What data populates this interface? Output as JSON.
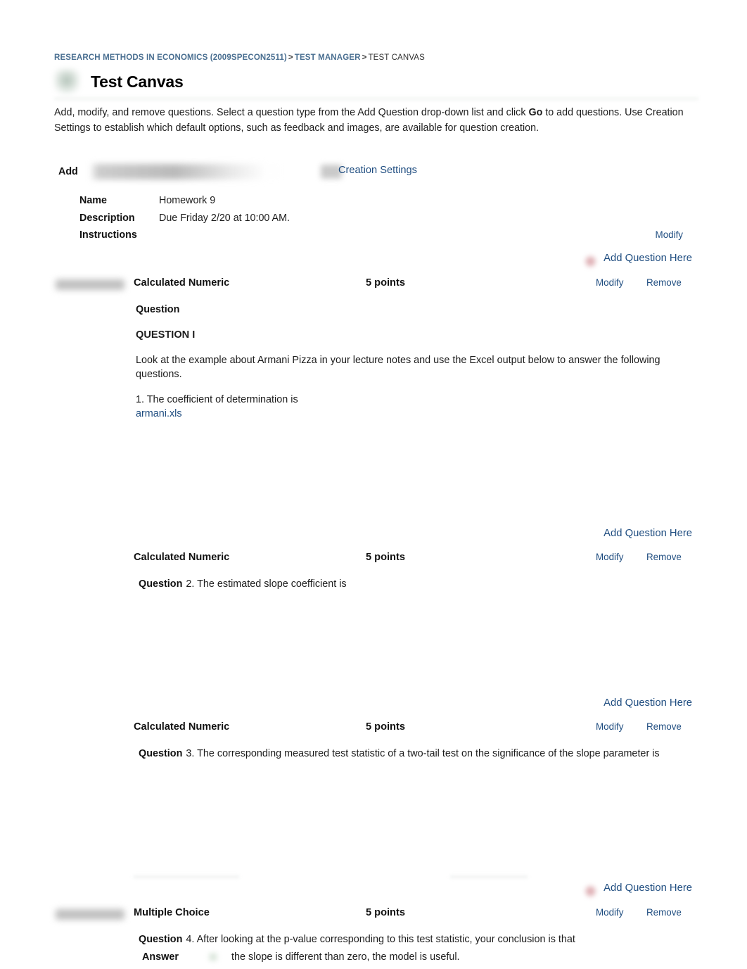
{
  "breadcrumb": {
    "course": "RESEARCH METHODS IN ECONOMICS (2009SPECON2511)",
    "sep1": ">",
    "section": "TEST MANAGER",
    "sep2": ">",
    "current": "TEST CANVAS"
  },
  "header": {
    "title": "Test Canvas",
    "icon": "test-canvas-icon"
  },
  "intro": {
    "part1": "Add, modify, and remove questions. Select a question type from the Add Question drop-down list and click ",
    "bold": "Go",
    "part2": " to add questions. Use Creation Settings to establish which default options, such as feedback and images, are available for question creation."
  },
  "toolbar": {
    "add_label": "Add",
    "question_type_value": "",
    "go_label": "",
    "creation_settings_label": "Creation Settings"
  },
  "meta": {
    "name_key": "Name",
    "name_value": "Homework 9",
    "description_key": "Description",
    "description_value": "Due Friday 2/20 at 10:00 AM.",
    "instructions_key": "Instructions",
    "instructions_value": "",
    "modify_label": "Modify"
  },
  "labels": {
    "add_question_here": "Add Question Here",
    "modify": "Modify",
    "remove": "Remove",
    "question": "Question",
    "answer": "Answer"
  },
  "questions": [
    {
      "type": "Calculated Numeric",
      "points": "5 points",
      "question_label": "Question",
      "heading": "QUESTION I",
      "body": "Look at the example about Armani Pizza in your lecture notes and use the Excel output below to answer the following questions.",
      "prompt": "1. The coefficient of determination is",
      "attachment": "armani.xls",
      "has_marker": true,
      "has_thumb": true
    },
    {
      "type": "Calculated Numeric",
      "points": "5 points",
      "question_label": "Question",
      "prompt": "2. The estimated slope coefficient is",
      "has_marker": false,
      "has_thumb": false
    },
    {
      "type": "Calculated Numeric",
      "points": "5 points",
      "question_label": "Question",
      "prompt": "3. The corresponding measured test statistic of a two-tail test on the significance of the slope parameter is",
      "has_marker": false,
      "has_thumb": false
    },
    {
      "type": "Multiple Choice",
      "points": "5 points",
      "question_label": "Question",
      "prompt": "4. After looking at the p-value corresponding to this test statistic, your conclusion is that",
      "answer_label": "Answer",
      "answer_text": "the slope is different than zero, the model is useful.",
      "has_marker": true,
      "has_thumb": true
    }
  ],
  "colors": {
    "link": "#1f4d80",
    "breadcrumb_link": "#4a6f91",
    "text": "#1c1c1c",
    "background": "#ffffff"
  }
}
